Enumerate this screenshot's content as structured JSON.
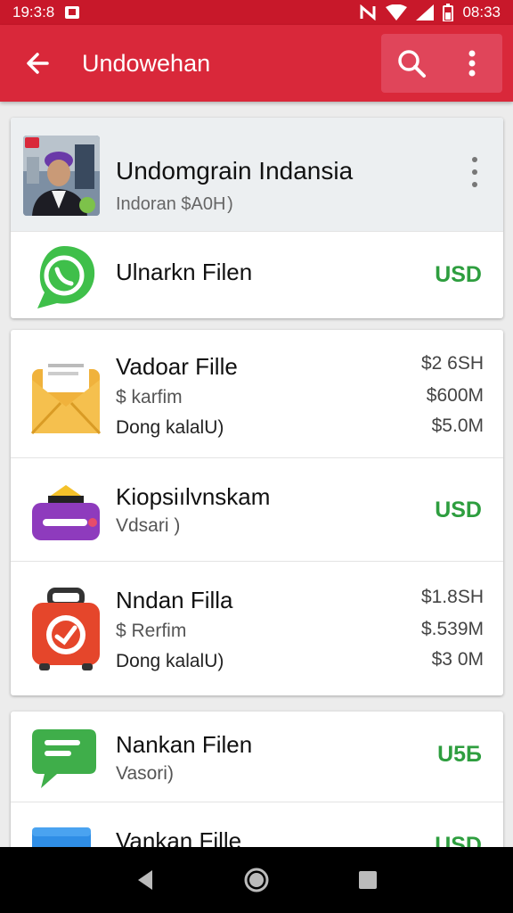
{
  "status_bar": {
    "time": "19:3:8",
    "right_time": "08:33"
  },
  "app_bar": {
    "title": "Undowehan",
    "back_icon": "arrow-back-icon",
    "search_icon": "search-icon",
    "more_icon": "more-vert-icon"
  },
  "profile": {
    "name": "Undomgrain Indansia",
    "subtitle": "Indoran $A0Н )"
  },
  "cards": [
    {
      "rows": [
        {
          "icon": "whatsapp-icon",
          "name": "Ulnarkn Filen",
          "badge": "USD"
        }
      ]
    },
    {
      "rows": [
        {
          "icon": "envelope-icon",
          "name": "Vadoar Fille",
          "line2": "$ karfim",
          "line3": "Dong kalalU)",
          "values": [
            "$2 6SH",
            "$600M",
            "$5.0M"
          ]
        },
        {
          "icon": "router-icon",
          "name": "Kiopsiılvnskam",
          "line2": "Vdsari )",
          "badge": "USD"
        },
        {
          "icon": "luggage-icon",
          "name": "Nndan Fillа",
          "line2": "$ Rerfim",
          "line3": "Dong kalalU)",
          "values": [
            "$1.8SH",
            "$.539M",
            "$3 0M"
          ]
        }
      ]
    },
    {
      "rows": [
        {
          "icon": "chat-bubble-icon",
          "name": "Nankan Filen",
          "line2": "Vasori)",
          "badge": "U5Б"
        },
        {
          "icon": "folder-icon",
          "name": "Vankan Fille",
          "badge": "USD"
        }
      ]
    }
  ],
  "nav": {
    "back": "nav-back-icon",
    "home": "nav-home-icon",
    "recents": "nav-recents-icon"
  },
  "colors": {
    "accent": "#d9283a",
    "status": "#c8182a",
    "positive": "#2e9e3f"
  }
}
